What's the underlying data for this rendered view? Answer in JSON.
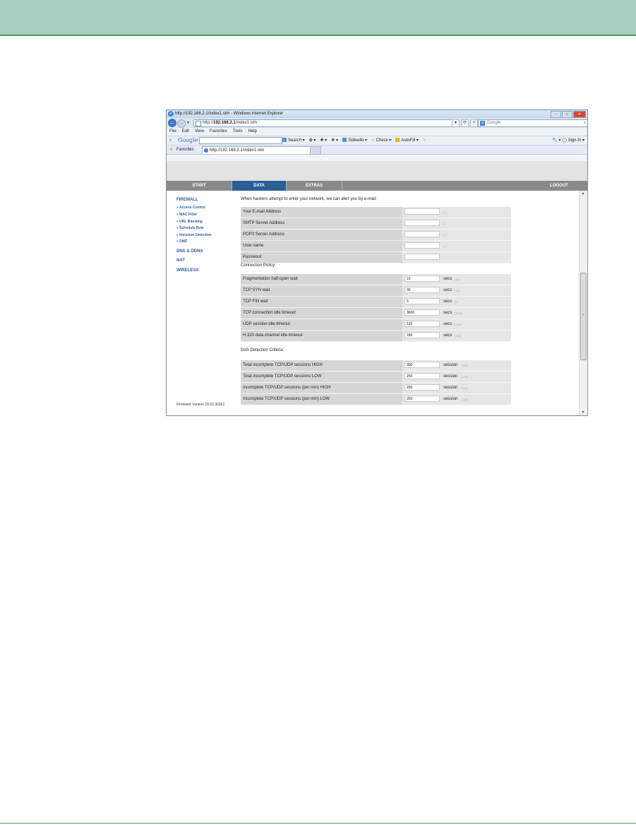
{
  "browser": {
    "title": "http://192.168.2.1/index1.stm - Windows Internet Explorer",
    "address_prefix": "http://",
    "address_host": "192.168.2.1",
    "address_path": "/index1.stm",
    "search_placeholder": "Google",
    "menu": [
      "File",
      "Edit",
      "View",
      "Favorites",
      "Tools",
      "Help"
    ],
    "google_toolbar": {
      "close": "x",
      "logo": "Google",
      "search": "Search",
      "sidewiki": "Sidewiki",
      "check": "Check",
      "autofill": "AutoFill",
      "sign_in": "Sign In"
    },
    "favorites_label": "Favorites",
    "tab_title": "http://192.168.2.1/index1.stm"
  },
  "router": {
    "nav": {
      "start": "START",
      "data": "DATA",
      "extras": "EXTRAS",
      "logout": "LOGOUT"
    },
    "sidebar": {
      "firewall": "FIREWALL",
      "sub_items": [
        "» Access Control",
        "» MAC Filter",
        "» URL Blocking",
        "» Schedule Rule",
        "» Intrusion Detection",
        "» DMZ"
      ],
      "dns": "DNS & DDNS",
      "nat": "NAT",
      "wireless": "WIRELESS",
      "firmware": "Firmware Version 20.03.30262"
    },
    "intro": "When hackers attempt to enter your network, we can alert you by e-mail:",
    "email_rows": [
      {
        "label": "Your E-mail Address",
        "hint": "( )"
      },
      {
        "label": "SMTP Server Address",
        "hint": "( )"
      },
      {
        "label": "POP3 Server Address",
        "hint": "( )"
      },
      {
        "label": "User name",
        "hint": "( )"
      },
      {
        "label": "Password",
        "hint": ""
      }
    ],
    "connection_label": "Connection Policy:",
    "connection_rows": [
      {
        "label": "Fragmentation half-open wait",
        "value": "10",
        "unit": "secs",
        "hint": "(10)"
      },
      {
        "label": "TCP SYN wait",
        "value": "30",
        "unit": "secs",
        "hint": "(30)"
      },
      {
        "label": "TCP FIN wait",
        "value": "5",
        "unit": "secs",
        "hint": "(5)"
      },
      {
        "label": "TCP connection idle timeout",
        "value": "3600",
        "unit": "secs",
        "hint": "(3600)"
      },
      {
        "label": "UDP session idle timeout",
        "value": "120",
        "unit": "secs",
        "hint": "(120)"
      },
      {
        "label": "H.323 data channel idle timeout",
        "value": "180",
        "unit": "secs",
        "hint": "(180)"
      }
    ],
    "dos_label": "DoS Detection Criteria:",
    "dos_rows": [
      {
        "label": "Total incomplete TCP/UDP sessions HIGH",
        "value": "300",
        "unit": "session",
        "hint": "(300)"
      },
      {
        "label": "Total incomplete TCP/UDP sessions LOW",
        "value": "250",
        "unit": "session",
        "hint": "(250)"
      },
      {
        "label": "Incomplete TCP/UDP sessions (per min) HIGH",
        "value": "250",
        "unit": "session",
        "hint": "(250)"
      },
      {
        "label": "Incomplete TCP/UDP sessions (per min) LOW",
        "value": "200",
        "unit": "session",
        "hint": "(200)"
      }
    ]
  }
}
